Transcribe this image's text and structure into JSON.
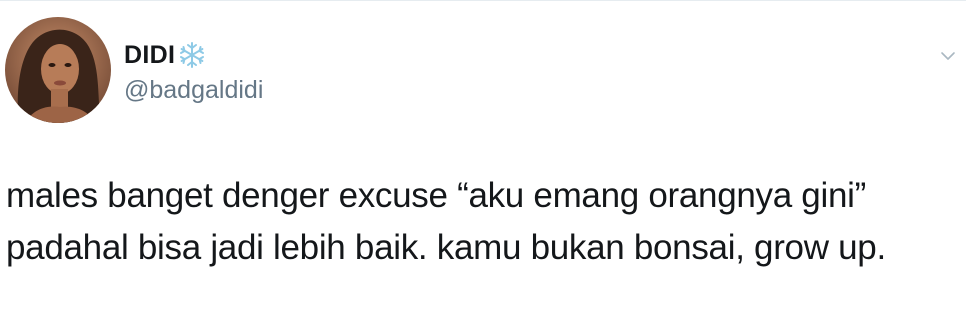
{
  "tweet": {
    "display_name": "DIDI",
    "name_emoji_icon": "snowflake-icon",
    "handle": "@badgaldidi",
    "text_lines": [
      "males banget denger excuse “aku emang orangnya gini”",
      "padahal bisa jadi lebih baik. kamu bukan bonsai, grow up."
    ],
    "menu_icon": "chevron-down-icon"
  },
  "colors": {
    "text_primary": "#14171a",
    "text_secondary": "#657786",
    "snowflake": "#8ecae6",
    "divider": "#e6ecf0"
  }
}
